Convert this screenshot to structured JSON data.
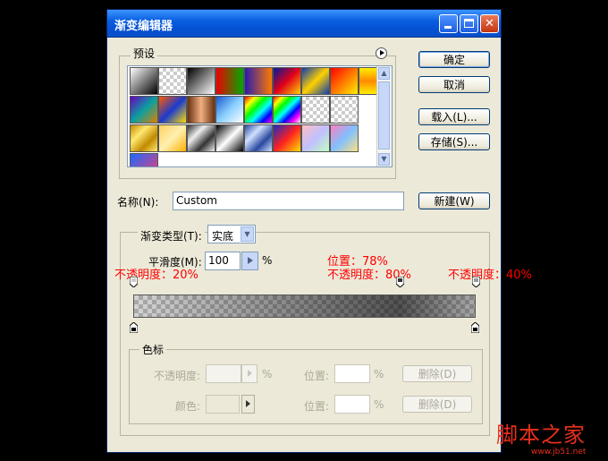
{
  "window": {
    "title": "渐变编辑器"
  },
  "presets": {
    "label": "预设"
  },
  "buttons": {
    "ok": "确定",
    "cancel": "取消",
    "load": "载入(L)...",
    "save": "存储(S)...",
    "new": "新建(W)"
  },
  "name": {
    "label": "名称(N):",
    "value": "Custom"
  },
  "gradient": {
    "type_label": "渐变类型(T):",
    "type_value": "实底",
    "smooth_label": "平滑度(M):",
    "smooth_value": "100",
    "smooth_unit": "%"
  },
  "annotations": {
    "opacity_left": "不透明度：20%",
    "position_mid": "位置：78%",
    "opacity_mid": "不透明度：80%",
    "opacity_right": "不透明度：40%"
  },
  "opacity_stops": [
    {
      "position": 0,
      "opacity": 20
    },
    {
      "position": 78,
      "opacity": 80
    },
    {
      "position": 100,
      "opacity": 40
    }
  ],
  "stops": {
    "label": "色标",
    "opacity_label": "不透明度:",
    "opacity_unit": "%",
    "position_label": "位置:",
    "position_unit": "%",
    "delete_label": "删除(D)",
    "color_label": "颜色:"
  },
  "watermark": {
    "text": "脚本之家",
    "url": "www.jb51.net"
  },
  "colors": {
    "titlebar": "#0a5fe0",
    "annotation": "#ff0000",
    "dialog_bg": "#ece9d8"
  }
}
